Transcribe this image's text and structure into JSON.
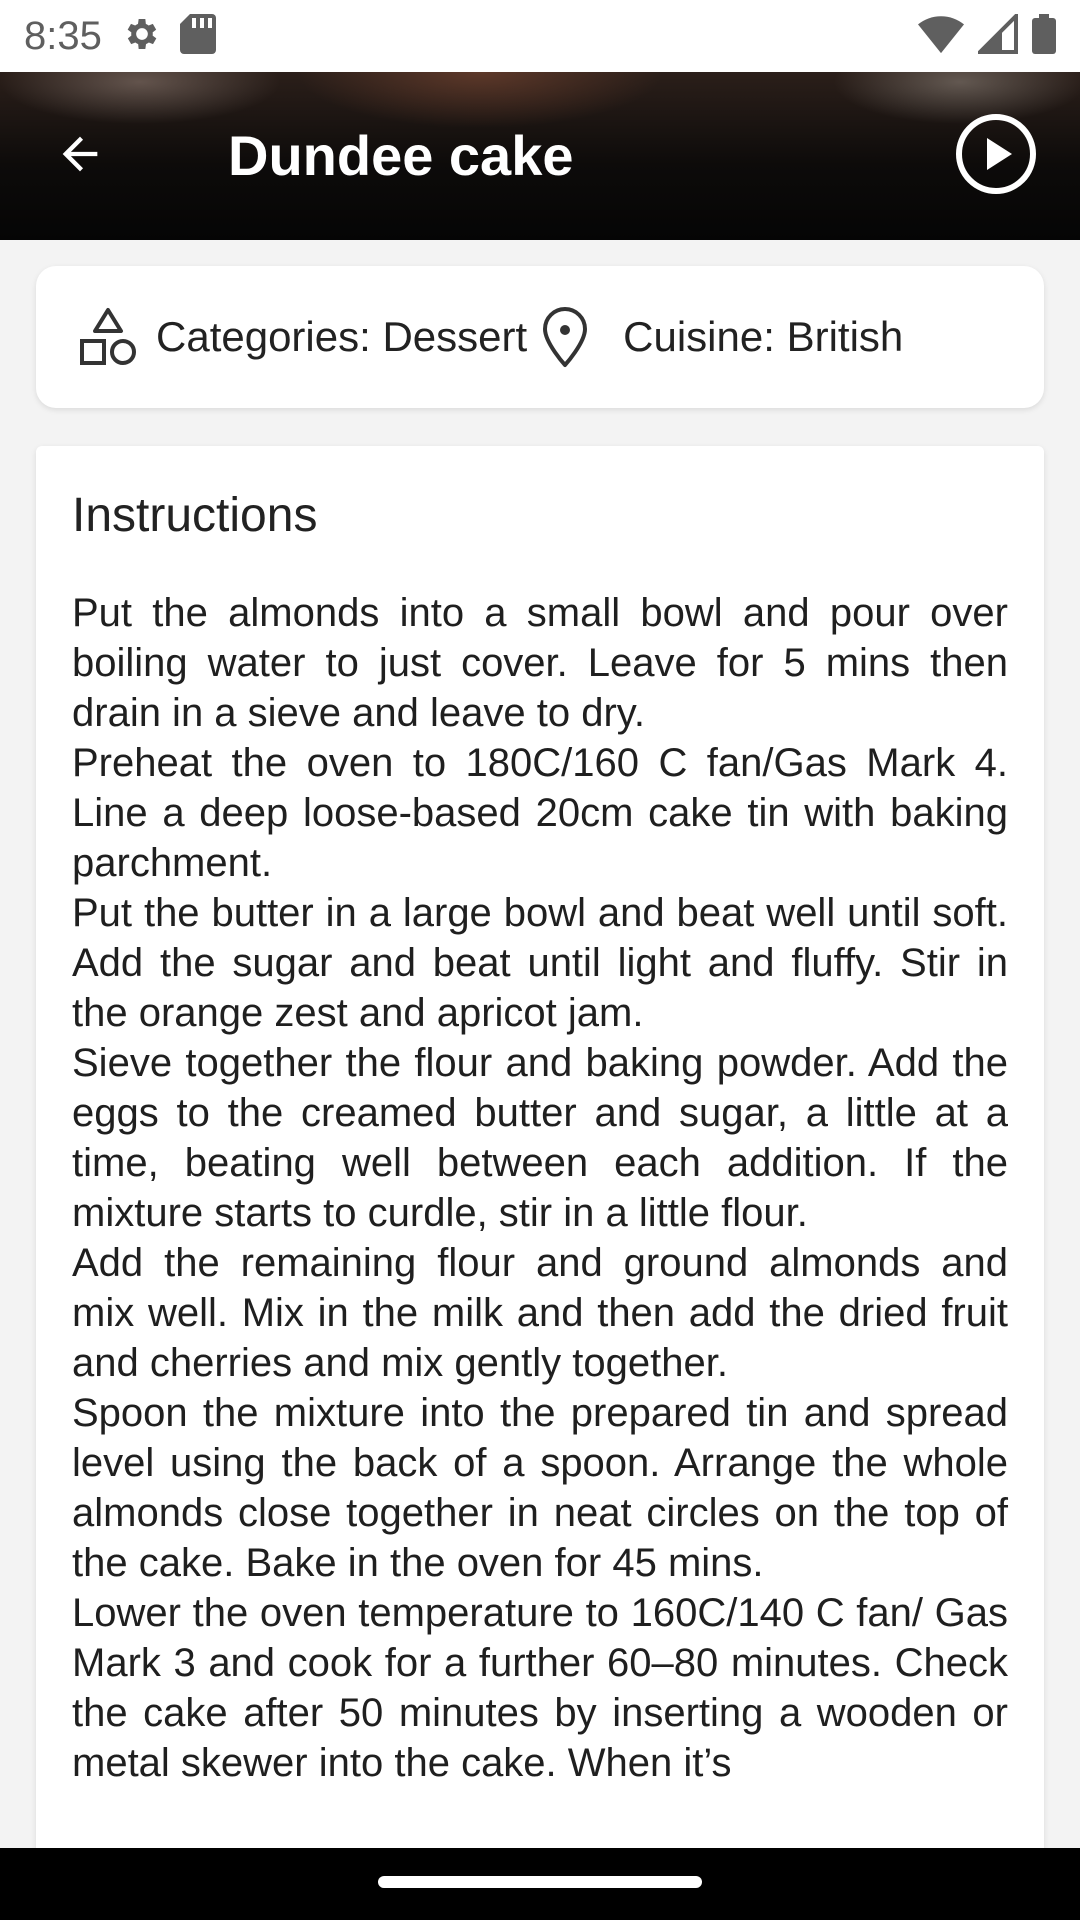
{
  "status_bar": {
    "time": "8:35",
    "icons_left": [
      "gear-icon",
      "sd-card-icon"
    ],
    "icons_right": [
      "wifi-icon",
      "signal-icon",
      "battery-icon"
    ]
  },
  "toolbar": {
    "title": "Dundee cake",
    "back_icon": "arrow-left-icon",
    "play_icon": "play-circle-icon"
  },
  "meta": {
    "categories": "Categories: Dessert",
    "cuisine": "Cuisine: British",
    "categories_icon": "shapes-icon",
    "cuisine_icon": "location-pin-icon"
  },
  "instructions": {
    "heading": "Instructions",
    "body": "Put the almonds into a small bowl and pour over boiling water to just cover. Leave for 5 mins then drain in a sieve and leave to dry.\nPreheat the oven to 180C/160 C fan/Gas Mark 4. Line a deep loose-based 20cm cake tin with baking parchment.\nPut the butter in a large bowl and beat well until soft. Add the sugar and beat until light and fluffy. Stir in the orange zest and apricot jam.\nSieve together the flour and baking powder. Add the eggs to the creamed butter and sugar, a little at a time, beating well between each addition. If the mixture starts to curdle, stir in a little flour.\nAdd the remaining flour and ground almonds and mix well. Mix in the milk and then add the dried fruit and cherries and mix gently together.\nSpoon the mixture into the prepared tin and spread level using the back of a spoon. Arrange the whole almonds close together in neat circles on the top of the cake. Bake in the oven for 45 mins.\nLower the oven temperature to 160C/140 C fan/ Gas Mark 3 and cook for a further 60–80 minutes. Check the cake after 50 minutes by inserting a wooden or metal skewer into the cake. When it’s"
  }
}
